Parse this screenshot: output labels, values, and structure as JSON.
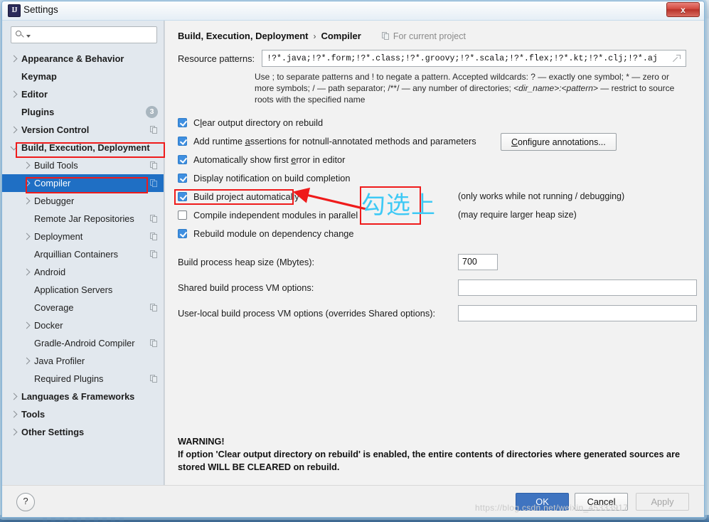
{
  "window": {
    "title": "Settings",
    "app_icon": "intellij-idea-icon",
    "close_label": "x"
  },
  "sidebar": {
    "search": {
      "value": "",
      "placeholder": ""
    },
    "items": [
      {
        "label": "Appearance & Behavior",
        "level": 0,
        "bold": true,
        "chevron": "right",
        "copy": false,
        "badge": null,
        "selected": false
      },
      {
        "label": "Keymap",
        "level": 0,
        "bold": true,
        "chevron": "none",
        "copy": false,
        "badge": null,
        "selected": false
      },
      {
        "label": "Editor",
        "level": 0,
        "bold": true,
        "chevron": "right",
        "copy": false,
        "badge": null,
        "selected": false
      },
      {
        "label": "Plugins",
        "level": 0,
        "bold": true,
        "chevron": "none",
        "copy": false,
        "badge": "3",
        "selected": false
      },
      {
        "label": "Version Control",
        "level": 0,
        "bold": true,
        "chevron": "right",
        "copy": true,
        "badge": null,
        "selected": false
      },
      {
        "label": "Build, Execution, Deployment",
        "level": 0,
        "bold": true,
        "chevron": "down",
        "copy": false,
        "badge": null,
        "selected": false
      },
      {
        "label": "Build Tools",
        "level": 1,
        "bold": false,
        "chevron": "right",
        "copy": true,
        "badge": null,
        "selected": false
      },
      {
        "label": "Compiler",
        "level": 1,
        "bold": false,
        "chevron": "right",
        "copy": true,
        "badge": null,
        "selected": true
      },
      {
        "label": "Debugger",
        "level": 1,
        "bold": false,
        "chevron": "right",
        "copy": false,
        "badge": null,
        "selected": false
      },
      {
        "label": "Remote Jar Repositories",
        "level": 1,
        "bold": false,
        "chevron": "none",
        "copy": true,
        "badge": null,
        "selected": false
      },
      {
        "label": "Deployment",
        "level": 1,
        "bold": false,
        "chevron": "right",
        "copy": true,
        "badge": null,
        "selected": false
      },
      {
        "label": "Arquillian Containers",
        "level": 1,
        "bold": false,
        "chevron": "none",
        "copy": true,
        "badge": null,
        "selected": false
      },
      {
        "label": "Android",
        "level": 1,
        "bold": false,
        "chevron": "right",
        "copy": false,
        "badge": null,
        "selected": false
      },
      {
        "label": "Application Servers",
        "level": 1,
        "bold": false,
        "chevron": "none",
        "copy": false,
        "badge": null,
        "selected": false
      },
      {
        "label": "Coverage",
        "level": 1,
        "bold": false,
        "chevron": "none",
        "copy": true,
        "badge": null,
        "selected": false
      },
      {
        "label": "Docker",
        "level": 1,
        "bold": false,
        "chevron": "right",
        "copy": false,
        "badge": null,
        "selected": false
      },
      {
        "label": "Gradle-Android Compiler",
        "level": 1,
        "bold": false,
        "chevron": "none",
        "copy": true,
        "badge": null,
        "selected": false
      },
      {
        "label": "Java Profiler",
        "level": 1,
        "bold": false,
        "chevron": "right",
        "copy": false,
        "badge": null,
        "selected": false
      },
      {
        "label": "Required Plugins",
        "level": 1,
        "bold": false,
        "chevron": "none",
        "copy": true,
        "badge": null,
        "selected": false
      },
      {
        "label": "Languages & Frameworks",
        "level": 0,
        "bold": true,
        "chevron": "right",
        "copy": false,
        "badge": null,
        "selected": false
      },
      {
        "label": "Tools",
        "level": 0,
        "bold": true,
        "chevron": "right",
        "copy": false,
        "badge": null,
        "selected": false
      },
      {
        "label": "Other Settings",
        "level": 0,
        "bold": true,
        "chevron": "right",
        "copy": false,
        "badge": null,
        "selected": false
      }
    ]
  },
  "main": {
    "breadcrumb_root": "Build, Execution, Deployment",
    "breadcrumb_sep": "›",
    "breadcrumb_leaf": "Compiler",
    "for_current_project": "For current project",
    "resource_patterns_label": "Resource patterns:",
    "resource_patterns_value": "!?*.java;!?*.form;!?*.class;!?*.groovy;!?*.scala;!?*.flex;!?*.kt;!?*.clj;!?*.aj",
    "hint_part1": "Use ; to separate patterns and ! to negate a pattern. Accepted wildcards: ? — exactly one symbol; * — zero or more symbols; / — path separator; /**/ — any number of directories; ",
    "hint_italic": "<dir_name>:<pattern>",
    "hint_part2": " — restrict to source roots with the specified name",
    "checkboxes": [
      {
        "label_pre": "C",
        "label_mn": "l",
        "label_post": "ear output directory on rebuild",
        "checked": true,
        "note": ""
      },
      {
        "label_pre": "Add runtime ",
        "label_mn": "a",
        "label_post": "ssertions for notnull-annotated methods and parameters",
        "checked": true,
        "note": ""
      },
      {
        "label_pre": "Automatically show first ",
        "label_mn": "e",
        "label_post": "rror in editor",
        "checked": true,
        "note": ""
      },
      {
        "label_pre": "Display notification on build completion",
        "label_mn": "",
        "label_post": "",
        "checked": true,
        "note": ""
      },
      {
        "label_pre": "Build project automatically",
        "label_mn": "",
        "label_post": "",
        "checked": true,
        "note": "(only works while not running / debugging)"
      },
      {
        "label_pre": "Compile independent modules in parallel",
        "label_mn": "",
        "label_post": "",
        "checked": false,
        "note": "(may require larger heap size)"
      },
      {
        "label_pre": "Rebuild module on dependency change",
        "label_mn": "",
        "label_post": "",
        "checked": true,
        "note": ""
      }
    ],
    "configure_annotations_pre": "C",
    "configure_annotations_label": "onfigure annotations...",
    "heap_label": "Build process heap size (Mbytes):",
    "heap_value": "700",
    "shared_vm_label": "Shared build process VM options:",
    "shared_vm_value": "",
    "userlocal_vm_label": "User-local build process VM options (overrides Shared options):",
    "userlocal_vm_value": "",
    "warning_title": "WARNING!",
    "warning_body": "If option 'Clear output directory on rebuild' is enabled, the entire contents of directories where generated sources are stored WILL BE CLEARED on rebuild."
  },
  "footer": {
    "help_label": "?",
    "ok_label": "OK",
    "cancel_label": "Cancel",
    "apply_label": "Apply"
  },
  "annotations": {
    "chinese_note": "勾选上",
    "box_color": "#ef1b1b",
    "text_color": "#3ec9f5",
    "watermark": "https://blog.csdn.net/weixin_45333917"
  }
}
